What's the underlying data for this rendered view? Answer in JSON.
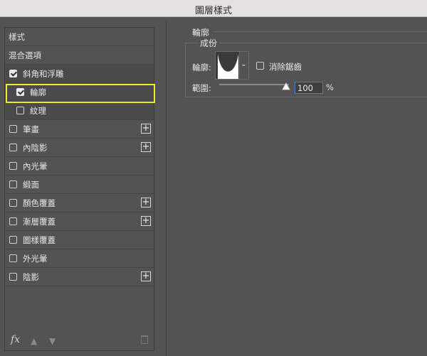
{
  "window": {
    "title": "圖層樣式"
  },
  "sidebar": {
    "header_styles": "樣式",
    "header_blending": "混合選項",
    "items": [
      {
        "label": "斜角和浮雕",
        "checked": true,
        "plus": false
      },
      {
        "label": "輪廓",
        "checked": true,
        "plus": false,
        "selected": true
      },
      {
        "label": "紋理",
        "checked": false,
        "plus": false
      },
      {
        "label": "筆畫",
        "checked": false,
        "plus": true
      },
      {
        "label": "內陰影",
        "checked": false,
        "plus": true
      },
      {
        "label": "內光暈",
        "checked": false,
        "plus": false
      },
      {
        "label": "緞面",
        "checked": false,
        "plus": false
      },
      {
        "label": "顏色覆蓋",
        "checked": false,
        "plus": true
      },
      {
        "label": "漸層覆蓋",
        "checked": false,
        "plus": true
      },
      {
        "label": "圖樣覆蓋",
        "checked": false,
        "plus": false
      },
      {
        "label": "外光暈",
        "checked": false,
        "plus": false
      },
      {
        "label": "陰影",
        "checked": false,
        "plus": true
      }
    ],
    "fx_label": "fx"
  },
  "panel": {
    "section_title": "輪廓",
    "group_title": "成份",
    "contour_label": "輪廓:",
    "anti_alias_label": "消除鋸齒",
    "range_label": "範圍:",
    "range_value": "100",
    "range_unit": "%"
  },
  "colors": {
    "highlight": "#f0ea2d",
    "focus": "#4a7cc4"
  }
}
